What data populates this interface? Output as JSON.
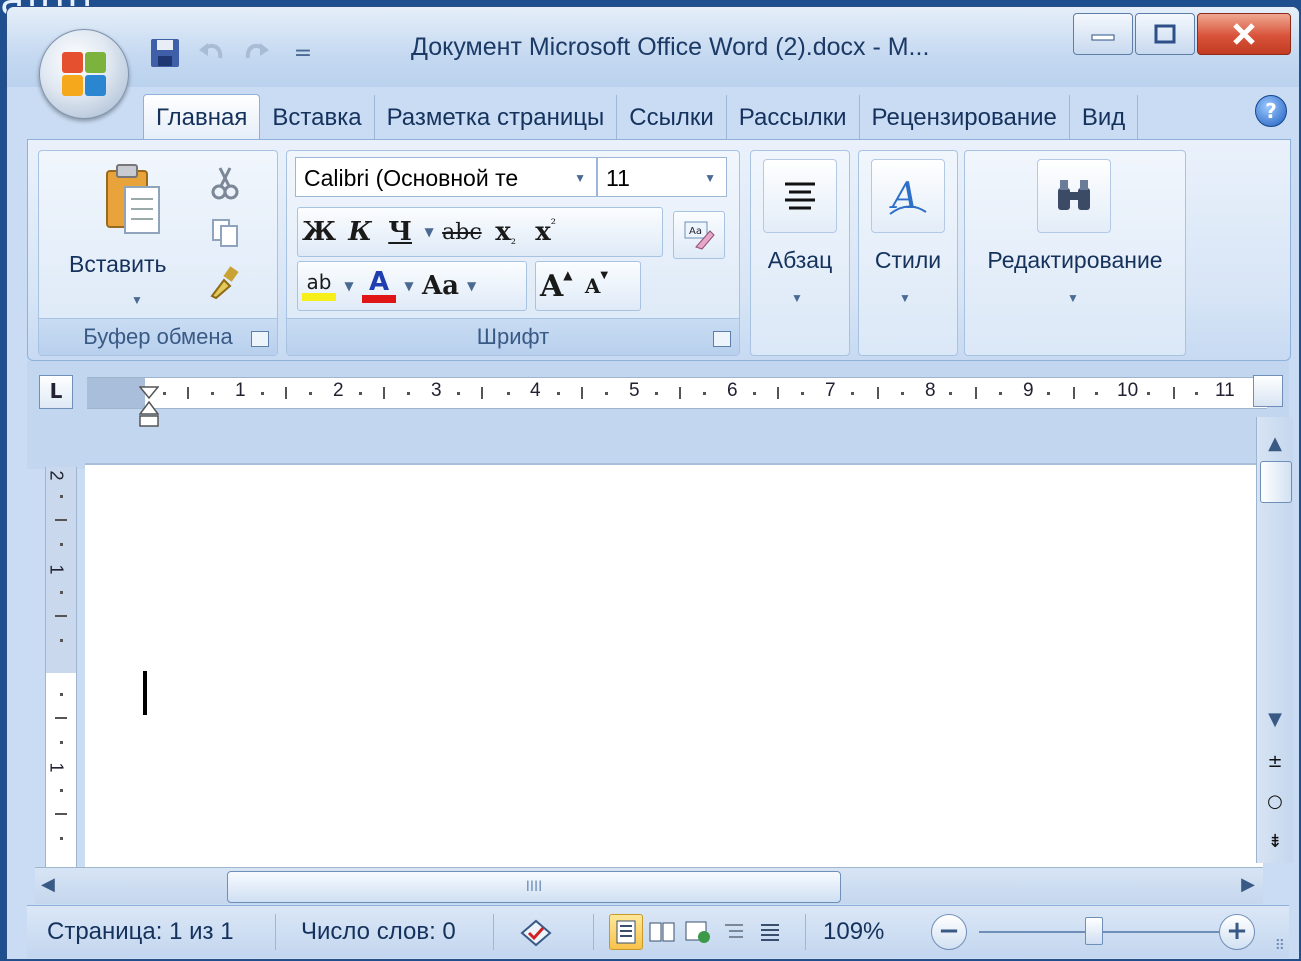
{
  "background_text": "ainn",
  "window": {
    "title": "Документ Microsoft Office Word (2).docx - M...",
    "buttons": {
      "minimize": "minimize-icon",
      "maximize": "maximize-icon",
      "close": "close-icon"
    }
  },
  "quick_access": {
    "items": [
      "save-icon",
      "undo-icon",
      "redo-icon",
      "customize-icon"
    ],
    "customize_glyph": "="
  },
  "tabs": [
    {
      "label": "Главная",
      "active": true
    },
    {
      "label": "Вставка",
      "active": false
    },
    {
      "label": "Разметка страницы",
      "active": false
    },
    {
      "label": "Ссылки",
      "active": false
    },
    {
      "label": "Рассылки",
      "active": false
    },
    {
      "label": "Рецензирование",
      "active": false
    },
    {
      "label": "Вид",
      "active": false
    }
  ],
  "help_glyph": "?",
  "ribbon": {
    "clipboard": {
      "paste_label": "Вставить",
      "group_label": "Буфер обмена"
    },
    "font": {
      "font_name": "Calibri (Основной те",
      "font_size": "11",
      "bold": "Ж",
      "italic": "К",
      "underline": "Ч",
      "strike": "abc",
      "subscript": "x",
      "superscript": "x",
      "highlight": "ab",
      "font_color": "A",
      "change_case": "Aa",
      "grow": "A",
      "shrink": "A",
      "group_label": "Шрифт"
    },
    "paragraph": {
      "label": "Абзац"
    },
    "styles": {
      "label": "Стили"
    },
    "editing": {
      "label": "Редактирование"
    },
    "colors": {
      "highlight": "#f7ef1a",
      "font_color": "#e01616"
    }
  },
  "ruler": {
    "tab_selector": "L",
    "numbers": [
      "1",
      "2",
      "3",
      "4",
      "5",
      "6",
      "7",
      "8",
      "9",
      "10",
      "11"
    ],
    "vertical_numbers": [
      "2",
      "1",
      "1"
    ]
  },
  "status": {
    "page": "Страница: 1 из 1",
    "words": "Число слов: 0",
    "zoom": "109%",
    "zoom_out": "−",
    "zoom_in": "+",
    "scroll_grip": "IIII"
  }
}
